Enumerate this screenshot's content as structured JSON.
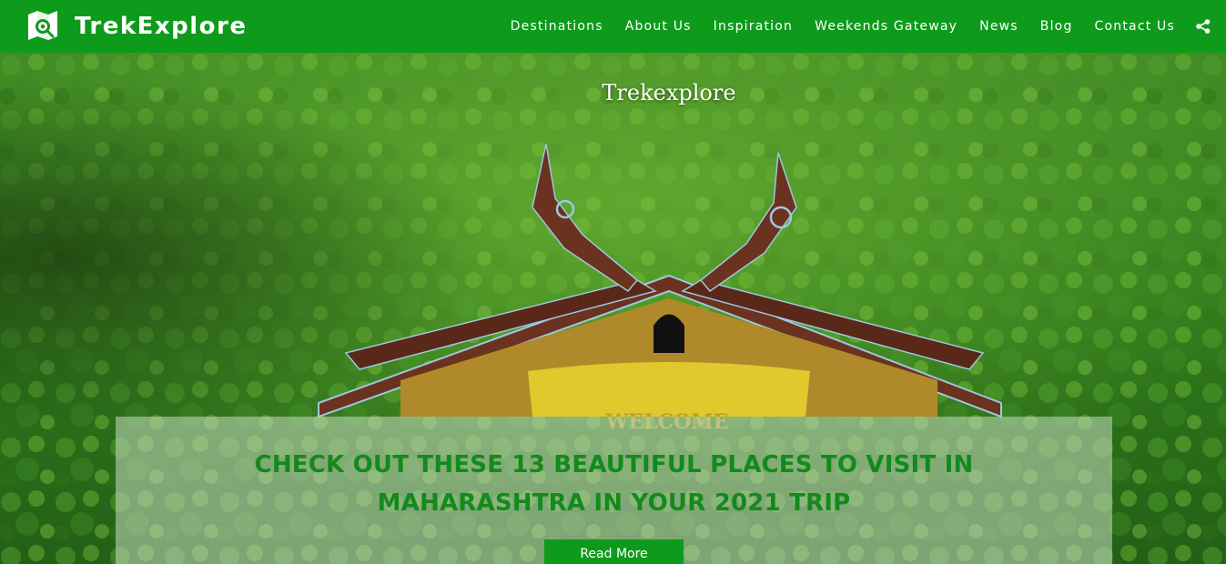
{
  "brand": {
    "name": "TrekExplore",
    "logo_icon": "eye-map-icon"
  },
  "nav": {
    "items": [
      {
        "label": "Destinations"
      },
      {
        "label": "About Us"
      },
      {
        "label": "Inspiration"
      },
      {
        "label": "Weekends Gateway"
      },
      {
        "label": "News"
      },
      {
        "label": "Blog"
      },
      {
        "label": "Contact Us"
      }
    ],
    "share_icon": "share-icon"
  },
  "hero": {
    "watermark": "Trekexplore",
    "gate_sign": "WELCOME",
    "headline": "CHECK OUT THESE 13 BEAUTIFUL PLACES TO VISIT IN MAHARASHTRA IN YOUR 2021 TRIP",
    "button_label": "Read More"
  },
  "colors": {
    "brand_green": "#0e9b1c",
    "headline_green": "#138a1c",
    "gate_brown": "#6b3220"
  }
}
